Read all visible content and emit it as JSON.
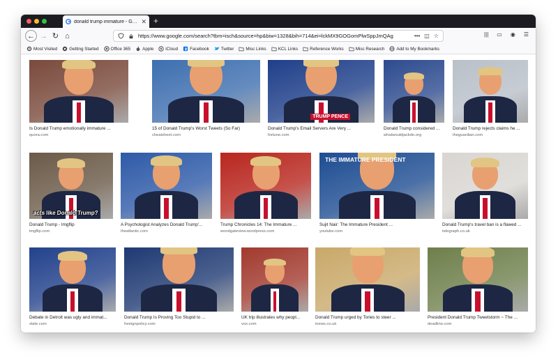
{
  "tab": {
    "title": "donald trump immature - Goog"
  },
  "url": "https://www.google.com/search?tbm=isch&source=hp&biw=1328&bih=714&ei=lckMX9GOGomPlwSppJmQAg",
  "bookmarks": [
    {
      "label": "Most Visited",
      "icon": "gear-icon"
    },
    {
      "label": "Getting Started",
      "icon": "firefox-icon"
    },
    {
      "label": "Office 365",
      "icon": "office-icon"
    },
    {
      "label": "Apple",
      "icon": "apple-icon"
    },
    {
      "label": "iCloud",
      "icon": "cloud-icon"
    },
    {
      "label": "Facebook",
      "icon": "facebook-icon"
    },
    {
      "label": "Twitter",
      "icon": "twitter-icon"
    },
    {
      "label": "Misc Links",
      "icon": "folder-icon"
    },
    {
      "label": "KCL Links",
      "icon": "folder-icon"
    },
    {
      "label": "Reference Works",
      "icon": "folder-icon"
    },
    {
      "label": "Misc Research",
      "icon": "folder-icon"
    },
    {
      "label": "Add to My Bookmarks",
      "icon": "globe-icon"
    }
  ],
  "results": [
    {
      "title": "Is Donald Trump emotionally immature ...",
      "source": "quora.com",
      "bg": "#7a4a3c",
      "text": ""
    },
    {
      "title": "15 of Donald Trump's Worst Tweets (So Far)",
      "source": "cheatsheet.com",
      "bg": "#3e6fb0",
      "text": ""
    },
    {
      "title": "Donald Trump's Email Servers Are Very ...",
      "source": "fortune.com",
      "bg": "#1f3f8a",
      "text": "TRUMP PENCE"
    },
    {
      "title": "Donald Trump considered ...",
      "source": "whatwouldjackdo.org",
      "bg": "#2d4b8f",
      "text": ""
    },
    {
      "title": "Donald Trump rejects claims he ...",
      "source": "theguardian.com",
      "bg": "#b9c0c9",
      "text": ""
    },
    {
      "title": "Donald Trump - Imgflip",
      "source": "imgflip.com",
      "bg": "#6b5a48",
      "text": "acts like Donald Trump?"
    },
    {
      "title": "A Psychologist Analyzes Donald Trump'...",
      "source": "theatlantic.com",
      "bg": "#2e5aa8",
      "text": ""
    },
    {
      "title": "Trump Chronicles 14: The Immature ...",
      "source": "woodgateview.wordpress.com",
      "bg": "#b8271f",
      "text": ""
    },
    {
      "title": "Sujit Nair: The Immature President ...",
      "source": "youtube.com",
      "bg": "#1e4d92",
      "text": "THE IMMATURE PRESIDENT"
    },
    {
      "title": "Donald Trump's travel ban is a flawed ...",
      "source": "telegraph.co.uk",
      "bg": "#d9d6d2",
      "text": ""
    },
    {
      "title": "Debate in Detroit was ugly and immat...",
      "source": "slate.com",
      "bg": "#23428c",
      "text": ""
    },
    {
      "title": "Donald Trump Is Proving Too Stupid to ...",
      "source": "foreignpolicy.com",
      "bg": "#1f3a73",
      "text": ""
    },
    {
      "title": "UK trip illustrates why peopl...",
      "source": "vox.com",
      "bg": "#a23a2e",
      "text": ""
    },
    {
      "title": "Donald Trump urged by Tories to steer ...",
      "source": "inews.co.uk",
      "bg": "#c9a96a",
      "text": ""
    },
    {
      "title": "President Donald Trump Tweetstorm ~ The ...",
      "source": "deadline.com",
      "bg": "#6e7f4b",
      "text": ""
    }
  ]
}
